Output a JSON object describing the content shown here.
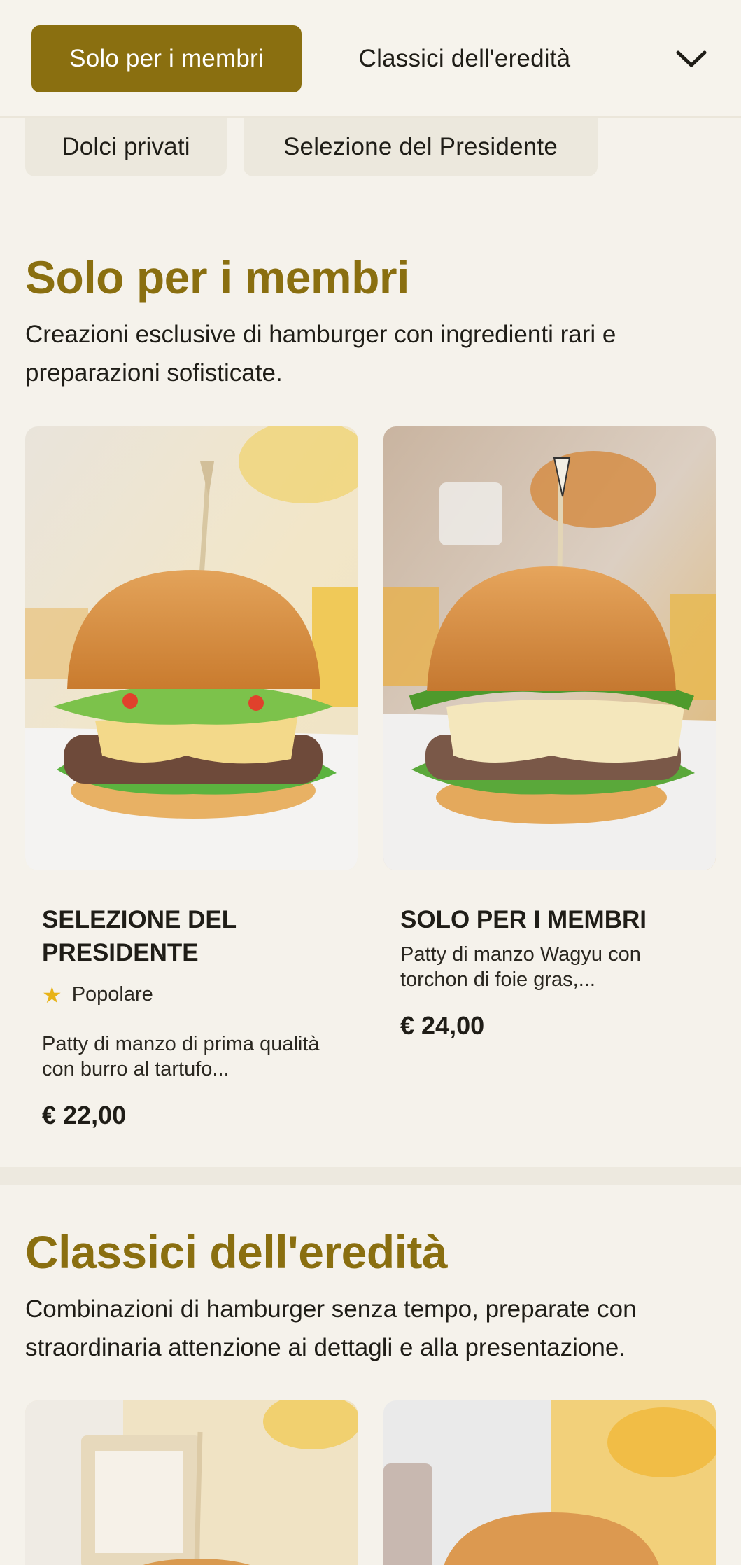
{
  "nav": {
    "active_chip": "Solo per i membri",
    "chip_2": "Classici dell'eredità",
    "chip_3": "Dolci privati",
    "chip_4": "Selezione del Presidente",
    "toggle_icon": "chevron-down-icon"
  },
  "sections": [
    {
      "title": "Solo per i membri",
      "description": "Creazioni esclusive di hamburger con ingredienti rari e preparazioni sofisticate.",
      "items": [
        {
          "name": "SELEZIONE DEL PRESIDENTE",
          "badge": "Popolare",
          "badge_icon": "star-icon",
          "description": "Patty di manzo di prima qualità con burro al tartufo...",
          "price": "€ 22,00"
        },
        {
          "name": "SOLO PER I MEMBRI",
          "description": "Patty di manzo Wagyu con torchon di foie gras,...",
          "price": "€ 24,00"
        }
      ]
    },
    {
      "title": "Classici dell'eredità",
      "description": "Combinazioni di hamburger senza tempo, preparate con straordinaria attenzione ai dettagli e alla presentazione."
    }
  ],
  "colors": {
    "accent": "#8a6f10",
    "background": "#f5f2eb",
    "chip_background": "#ece8dd",
    "star": "#e8b317"
  }
}
